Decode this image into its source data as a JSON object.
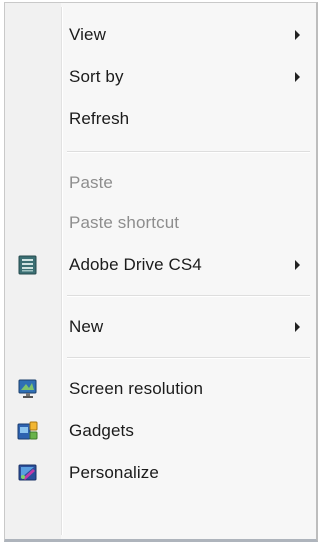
{
  "menu": {
    "items": [
      {
        "label": "View",
        "submenu": true,
        "enabled": true
      },
      {
        "label": "Sort by",
        "submenu": true,
        "enabled": true
      },
      {
        "label": "Refresh",
        "submenu": false,
        "enabled": true
      },
      {
        "label": "Paste",
        "submenu": false,
        "enabled": false
      },
      {
        "label": "Paste shortcut",
        "submenu": false,
        "enabled": false
      },
      {
        "label": "Adobe Drive CS4",
        "submenu": true,
        "enabled": true,
        "icon": "adobe-drive-icon"
      },
      {
        "label": "New",
        "submenu": true,
        "enabled": true
      },
      {
        "label": "Screen resolution",
        "submenu": false,
        "enabled": true,
        "icon": "screen-resolution-icon"
      },
      {
        "label": "Gadgets",
        "submenu": false,
        "enabled": true,
        "icon": "gadgets-icon"
      },
      {
        "label": "Personalize",
        "submenu": false,
        "enabled": true,
        "icon": "personalize-icon"
      }
    ]
  }
}
